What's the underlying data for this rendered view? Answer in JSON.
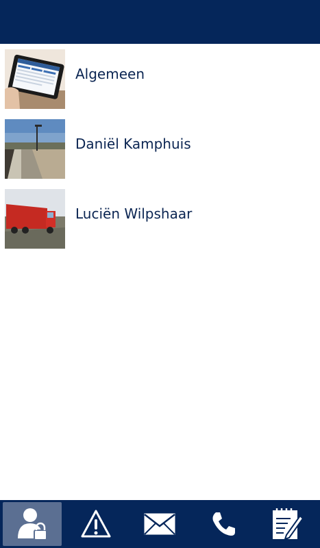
{
  "contacts": [
    {
      "name": "Algemeen",
      "thumb": "tablet-photo"
    },
    {
      "name": "Daniël Kamphuis",
      "thumb": "railway-platform-photo"
    },
    {
      "name": "Luciën Wilpshaar",
      "thumb": "red-truck-photo"
    }
  ],
  "tabbar": {
    "tabs": [
      {
        "icon": "contact-lock-icon",
        "active": true
      },
      {
        "icon": "warning-icon",
        "active": false
      },
      {
        "icon": "mail-icon",
        "active": false
      },
      {
        "icon": "phone-icon",
        "active": false
      },
      {
        "icon": "notepad-icon",
        "active": false
      }
    ]
  },
  "colors": {
    "header": "#05265a",
    "text": "#0b2552",
    "active_tab": "#5b6f92"
  }
}
